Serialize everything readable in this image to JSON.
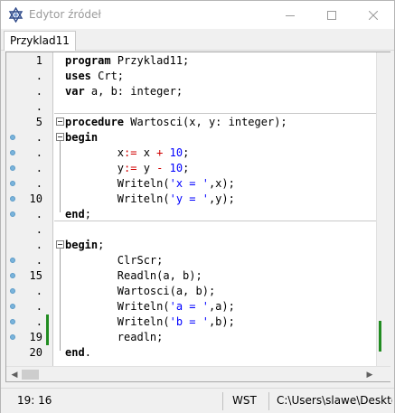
{
  "window": {
    "title": "Edytor źródeł",
    "icon": "star-of-david-icon"
  },
  "tabs": [
    {
      "label": "Przyklad11",
      "active": true
    }
  ],
  "gutter": {
    "line_labels": [
      "1",
      ".",
      ".",
      ".",
      "5",
      ".",
      ".",
      ".",
      ".",
      "10",
      ".",
      ".",
      ".",
      ".",
      "15",
      ".",
      ".",
      ".",
      "19",
      "20"
    ],
    "breakpoint_lines": [
      6,
      7,
      8,
      9,
      10,
      11,
      14,
      15,
      16,
      17,
      18,
      19
    ],
    "modified_lines": [
      18,
      19
    ]
  },
  "code": {
    "lines": [
      [
        {
          "t": "program",
          "c": "kw"
        },
        {
          "t": " Przyklad11;"
        }
      ],
      [
        {
          "t": "uses",
          "c": "kw"
        },
        {
          "t": " Crt;"
        }
      ],
      [
        {
          "t": "var",
          "c": "kw"
        },
        {
          "t": " a, b: integer;"
        }
      ],
      [
        {
          "t": ""
        }
      ],
      [
        {
          "t": "procedure",
          "c": "kw"
        },
        {
          "t": " Wartosci(x, y: integer);"
        }
      ],
      [
        {
          "t": "begin",
          "c": "kw"
        }
      ],
      [
        {
          "t": "        x"
        },
        {
          "t": ":=",
          "c": "sym"
        },
        {
          "t": " x "
        },
        {
          "t": "+",
          "c": "sym"
        },
        {
          "t": " "
        },
        {
          "t": "10",
          "c": "num"
        },
        {
          "t": ";"
        }
      ],
      [
        {
          "t": "        y"
        },
        {
          "t": ":=",
          "c": "sym"
        },
        {
          "t": " y "
        },
        {
          "t": "-",
          "c": "sym"
        },
        {
          "t": " "
        },
        {
          "t": "10",
          "c": "num"
        },
        {
          "t": ";"
        }
      ],
      [
        {
          "t": "        Writeln("
        },
        {
          "t": "'x = '",
          "c": "str"
        },
        {
          "t": ",x);"
        }
      ],
      [
        {
          "t": "        Writeln("
        },
        {
          "t": "'y = '",
          "c": "str"
        },
        {
          "t": ",y);"
        }
      ],
      [
        {
          "t": "end",
          "c": "kw"
        },
        {
          "t": ";"
        }
      ],
      [
        {
          "t": ""
        }
      ],
      [
        {
          "t": "begin",
          "c": "kw"
        },
        {
          "t": ";"
        }
      ],
      [
        {
          "t": "        ClrScr;"
        }
      ],
      [
        {
          "t": "        Readln(a, b);"
        }
      ],
      [
        {
          "t": "        Wartosci(a, b);"
        }
      ],
      [
        {
          "t": "        Writeln("
        },
        {
          "t": "'a = '",
          "c": "str"
        },
        {
          "t": ",a);"
        }
      ],
      [
        {
          "t": "        Writeln("
        },
        {
          "t": "'b = '",
          "c": "str"
        },
        {
          "t": ",b);"
        }
      ],
      [
        {
          "t": "        readln;"
        }
      ],
      [
        {
          "t": "end",
          "c": "kw"
        },
        {
          "t": "."
        }
      ]
    ]
  },
  "status": {
    "position": "19: 16",
    "mode": "WST",
    "path": "C:\\Users\\slawe\\Deskto"
  },
  "colors": {
    "string": "#0000ff",
    "number": "#0000ff",
    "symbol": "#d00000",
    "modified_marker": "#218c21",
    "breakpoint": "#7ab4dc"
  }
}
